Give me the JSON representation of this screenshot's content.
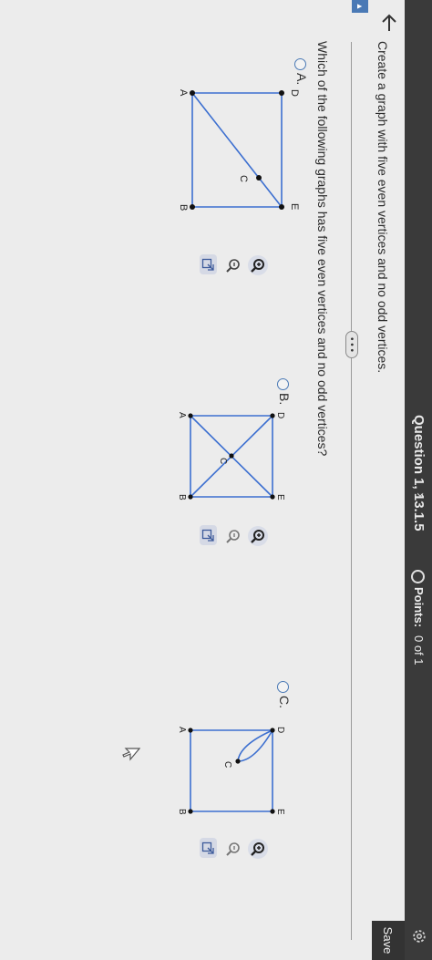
{
  "header": {
    "title": "Question 1, 13.1.5",
    "points_label": "Points:",
    "points_value": "0 of 1",
    "save_label": "Save"
  },
  "prompt": "Create a graph with five even vertices and no odd vertices.",
  "more_label": "• • •",
  "question": "Which of the following graphs has five even vertices and no odd vertices?",
  "options": [
    {
      "label": "A.",
      "vertices": [
        "A",
        "B",
        "C",
        "D",
        "E"
      ]
    },
    {
      "label": "B.",
      "vertices": [
        "A",
        "B",
        "C",
        "D",
        "E"
      ]
    },
    {
      "label": "C.",
      "vertices": [
        "A",
        "B",
        "C",
        "D",
        "E"
      ]
    }
  ],
  "colors": {
    "accent": "#4a79b5",
    "edge": "#3c6fd0",
    "vertex": "#111111"
  },
  "icons": [
    "back-arrow-icon",
    "gear-icon",
    "zoom-in-icon",
    "zoom-out-icon",
    "popout-icon",
    "cursor-icon"
  ]
}
